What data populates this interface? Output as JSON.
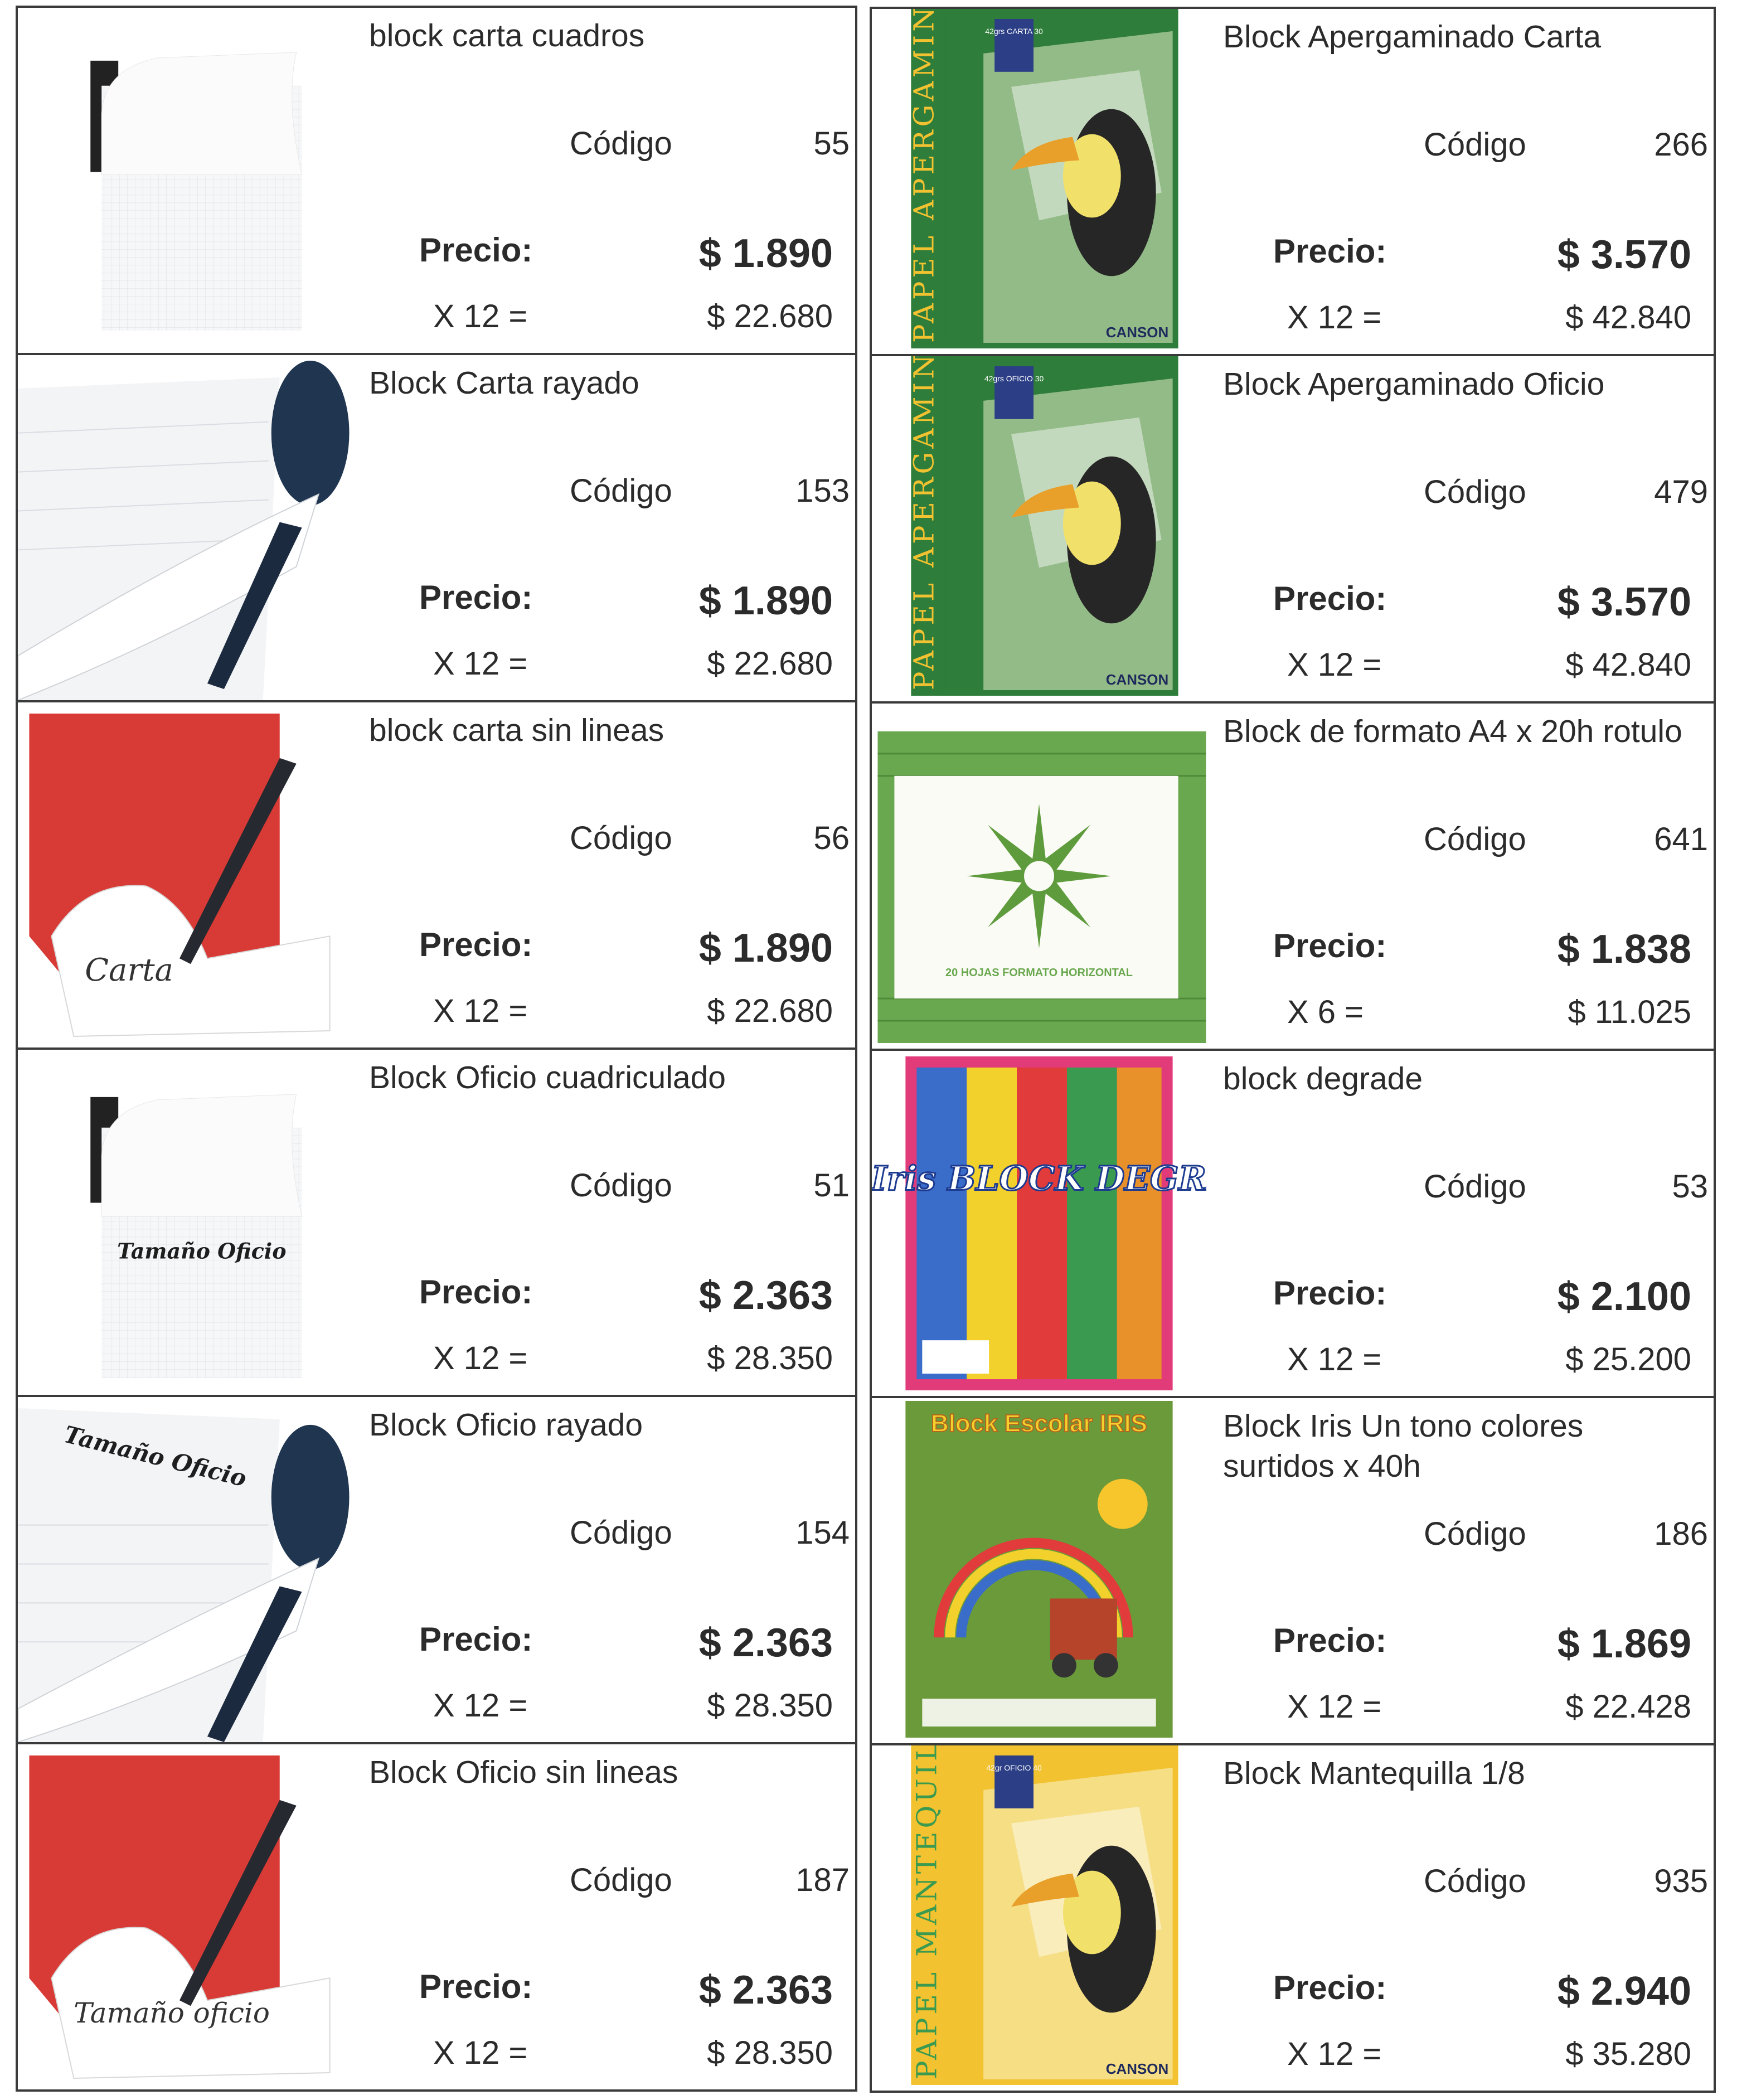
{
  "labels": {
    "codigo": "Código",
    "precio": "Precio:"
  },
  "left_items": [
    {
      "title": "block carta cuadros",
      "code": "55",
      "price": "$ 1.890",
      "multiplier": "X 12 =",
      "total": "$ 22.680",
      "image": "grid-notepad"
    },
    {
      "title": "Block Carta rayado",
      "code": "153",
      "price": "$ 1.890",
      "multiplier": "X 12 =",
      "total": "$ 22.680",
      "image": "lined-notepad"
    },
    {
      "title": "block carta sin lineas",
      "code": "56",
      "price": "$ 1.890",
      "multiplier": "X 12 =",
      "total": "$ 22.680",
      "image": "red-notepad-pen",
      "image_text": "Carta"
    },
    {
      "title": "Block Oficio cuadriculado",
      "code": "51",
      "price": "$ 2.363",
      "multiplier": "X 12 =",
      "total": "$ 28.350",
      "image": "grid-notepad",
      "image_text": "Tamaño Oficio"
    },
    {
      "title": "Block Oficio rayado",
      "code": "154",
      "price": "$ 2.363",
      "multiplier": "X 12 =",
      "total": "$ 28.350",
      "image": "lined-notepad",
      "image_text": "Tamaño Oficio"
    },
    {
      "title": "Block Oficio sin lineas",
      "code": "187",
      "price": "$ 2.363",
      "multiplier": "X 12 =",
      "total": "$ 28.350",
      "image": "red-notepad-pen",
      "image_text": "Tamaño oficio"
    }
  ],
  "right_items": [
    {
      "title": "Block Apergaminado Carta",
      "code": "266",
      "price": "$ 3.570",
      "multiplier": "X 12 =",
      "total": "$ 42.840",
      "image": "canson-toucan-green",
      "image_text": "PAPEL APERGAMINADO",
      "badge": "42grs CARTA 30",
      "brand": "CANSON"
    },
    {
      "title": "Block Apergaminado Oficio",
      "code": "479",
      "price": "$ 3.570",
      "multiplier": "X 12 =",
      "total": "$ 42.840",
      "image": "canson-toucan-green",
      "image_text": "PAPEL APERGAMINADO",
      "badge": "42grs OFICIO 30",
      "brand": "CANSON"
    },
    {
      "title": "Block de formato A4 x 20h rotulo",
      "code": "641",
      "price": "$ 1.838",
      "multiplier": "X 6 =",
      "total": "$ 11.025",
      "image": "green-sunburst-pad",
      "image_text": "20 HOJAS FORMATO HORIZONTAL"
    },
    {
      "title": "block degrade",
      "code": "53",
      "price": "$ 2.100",
      "multiplier": "X 12 =",
      "total": "$ 25.200",
      "image": "eco-iris-degrade",
      "image_text": "Eco Iris BLOCK DEGRADE"
    },
    {
      "title": "Block Iris Un tono colores surtidos x 40h",
      "code": "186",
      "price": "$ 1.869",
      "multiplier": "X 12 =",
      "total": "$ 22.428",
      "image": "block-escolar-iris",
      "image_text": "Block Escolar IRIS"
    },
    {
      "title": "Block Mantequilla 1/8",
      "code": "935",
      "price": "$ 2.940",
      "multiplier": "X 12 =",
      "total": "$ 35.280",
      "image": "canson-toucan-yellow",
      "image_text": "PAPEL MANTEQUILLA",
      "badge": "42gr OFICIO 40",
      "brand": "CANSON"
    }
  ],
  "colors": {
    "border": "#3a3a3a",
    "canson_green": "#2e7d3a",
    "canson_yellow": "#f2c230",
    "notepad_red": "#d83a35",
    "sunburst_green": "#6aa84f"
  }
}
